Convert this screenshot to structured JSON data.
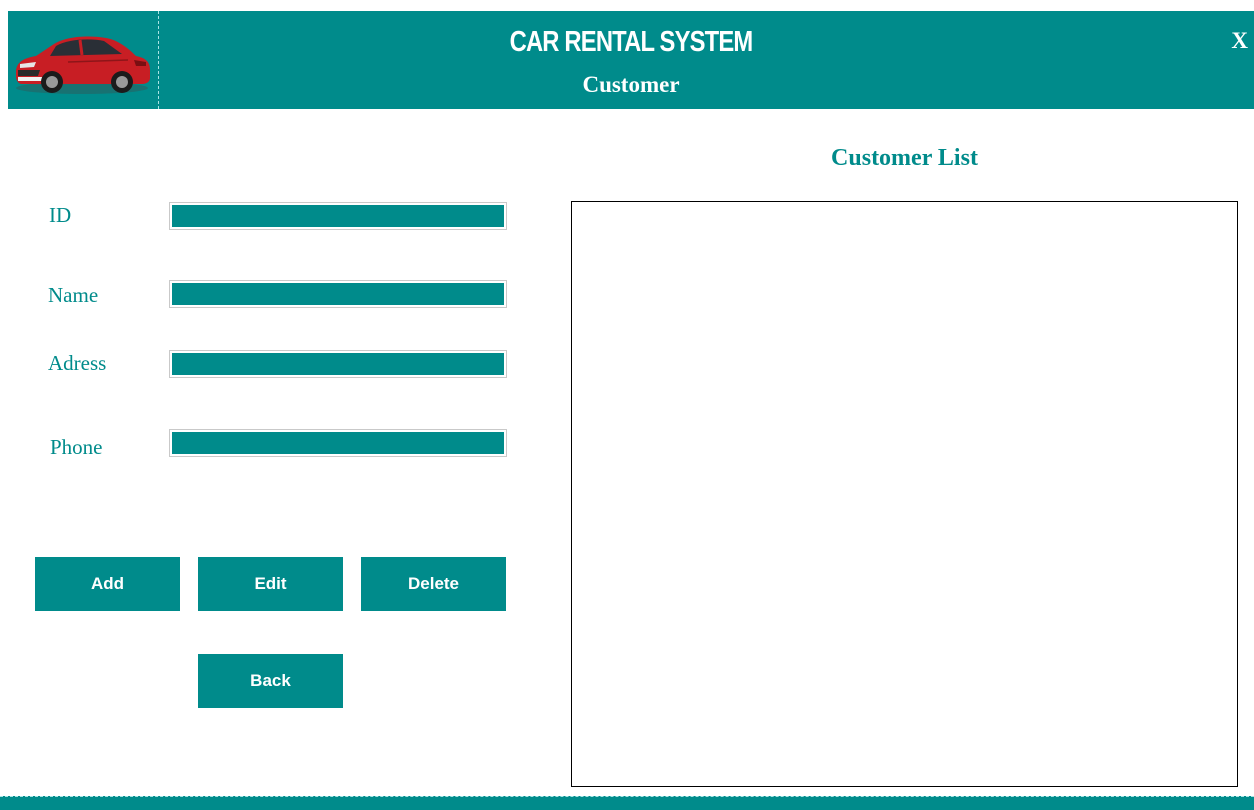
{
  "header": {
    "title": "CAR RENTAL SYSTEM",
    "subtitle": "Customer",
    "close_label": "X",
    "logo_icon": "car-icon",
    "background_color": "#008b8b"
  },
  "form": {
    "fields": [
      {
        "label": "ID",
        "value": ""
      },
      {
        "label": "Name",
        "value": ""
      },
      {
        "label": "Adress",
        "value": ""
      },
      {
        "label": "Phone",
        "value": ""
      }
    ]
  },
  "buttons": {
    "add": "Add",
    "edit": "Edit",
    "delete": "Delete",
    "back": "Back"
  },
  "customer_list": {
    "title": "Customer List",
    "rows": []
  },
  "colors": {
    "accent": "#008b8b",
    "text_on_accent": "#ffffff"
  }
}
